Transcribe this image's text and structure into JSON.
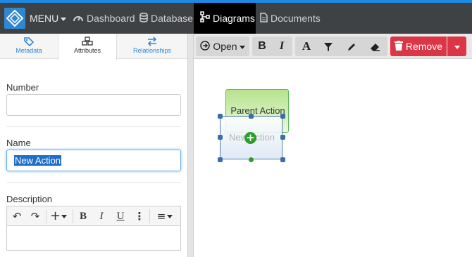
{
  "nav": {
    "menu_label": "MENU",
    "items": [
      {
        "label": "Dashboard",
        "icon": "gauge-icon"
      },
      {
        "label": "Database",
        "icon": "database-icon"
      },
      {
        "label": "Diagrams",
        "icon": "sitemap-icon",
        "active": true
      },
      {
        "label": "Documents",
        "icon": "document-icon"
      }
    ]
  },
  "left_panel": {
    "tabs": [
      {
        "label": "Metadata",
        "icon": "tag-icon"
      },
      {
        "label": "Attributes",
        "icon": "cubes-icon",
        "active": true
      },
      {
        "label": "Relationships",
        "icon": "exchange-icon"
      }
    ],
    "fields": {
      "number_label": "Number",
      "number_value": "",
      "name_label": "Name",
      "name_value": "New Action",
      "description_label": "Description",
      "description_value": ""
    }
  },
  "editor_toolbar": {
    "undo": "↶",
    "redo": "↷",
    "insert": "+",
    "bold": "B",
    "italic": "I",
    "underline": "U",
    "more": "⋮",
    "align": "≡"
  },
  "toolbar": {
    "open_label": "Open",
    "bold": "B",
    "italic": "I",
    "font": "A",
    "remove_label": "Remove"
  },
  "canvas": {
    "parent_shape_label": "Parent Action",
    "new_shape_label": "New Action",
    "add_symbol": "+"
  },
  "colors": {
    "accent": "#2f86d3",
    "topbar": "#3f4245",
    "remove": "#dc3545",
    "parent_shape": "#b6e38d",
    "handle": "#3a6ea5",
    "add": "#2aa02a"
  }
}
